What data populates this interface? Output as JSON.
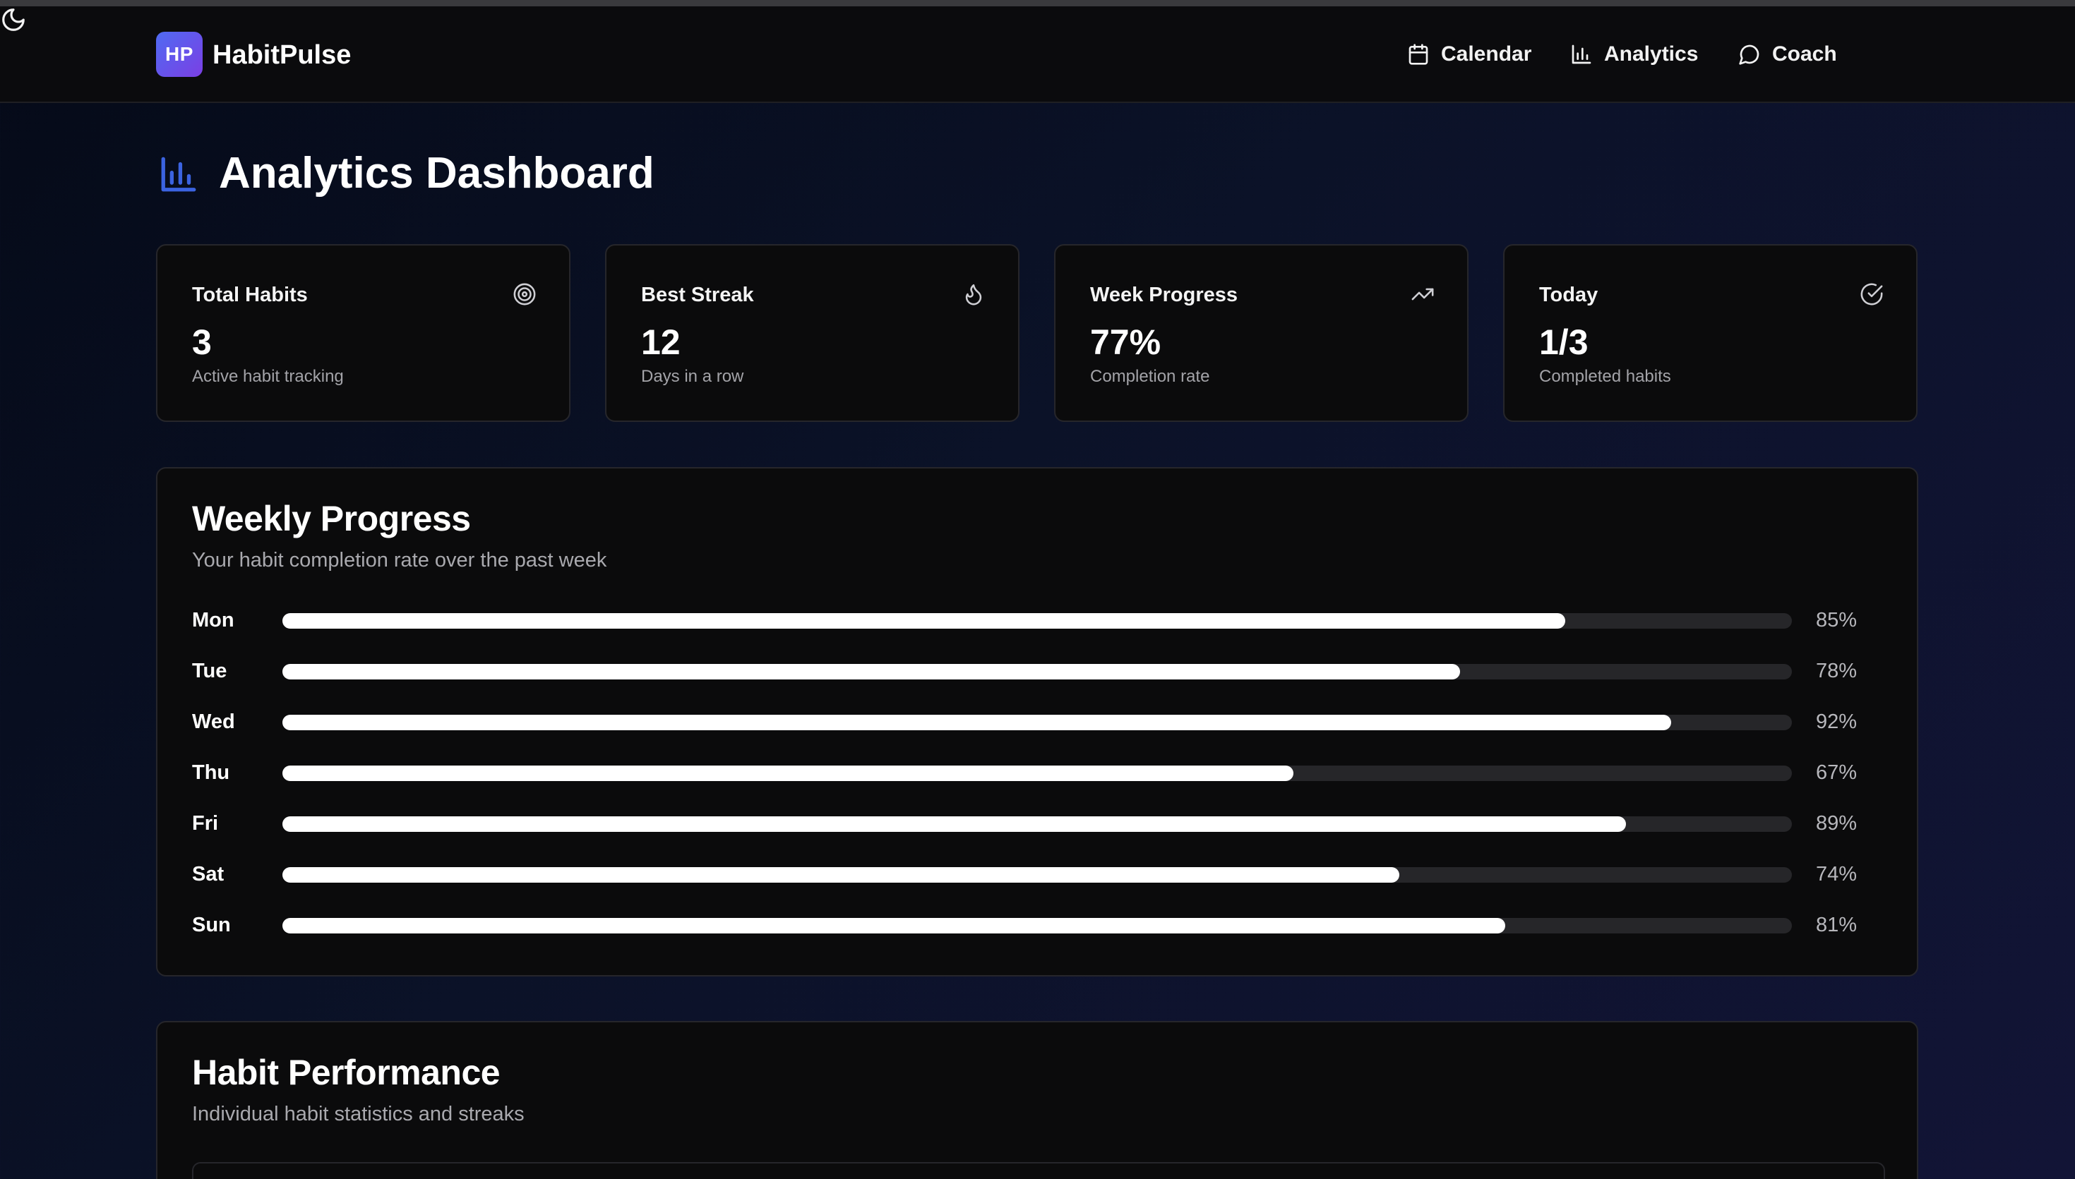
{
  "brand": {
    "logo_text": "HP",
    "name": "HabitPulse"
  },
  "nav": {
    "calendar": "Calendar",
    "analytics": "Analytics",
    "coach": "Coach"
  },
  "page": {
    "title": "Analytics Dashboard"
  },
  "stats": [
    {
      "label": "Total Habits",
      "value": "3",
      "sub": "Active habit tracking",
      "icon": "target-icon"
    },
    {
      "label": "Best Streak",
      "value": "12",
      "sub": "Days in a row",
      "icon": "flame-icon"
    },
    {
      "label": "Week Progress",
      "value": "77%",
      "sub": "Completion rate",
      "icon": "trending-up-icon"
    },
    {
      "label": "Today",
      "value": "1/3",
      "sub": "Completed habits",
      "icon": "check-circle-icon"
    }
  ],
  "weekly": {
    "title": "Weekly Progress",
    "subtitle": "Your habit completion rate over the past week",
    "days": [
      {
        "day": "Mon",
        "percent": 85,
        "label": "85%"
      },
      {
        "day": "Tue",
        "percent": 78,
        "label": "78%"
      },
      {
        "day": "Wed",
        "percent": 92,
        "label": "92%"
      },
      {
        "day": "Thu",
        "percent": 67,
        "label": "67%"
      },
      {
        "day": "Fri",
        "percent": 89,
        "label": "89%"
      },
      {
        "day": "Sat",
        "percent": 74,
        "label": "74%"
      },
      {
        "day": "Sun",
        "percent": 81,
        "label": "81%"
      }
    ]
  },
  "performance": {
    "title": "Habit Performance",
    "subtitle": "Individual habit statistics and streaks"
  },
  "colors": {
    "accent_gradient_start": "#4f6bf2",
    "accent_gradient_end": "#7b3fe4",
    "title_icon": "#3b63e0",
    "bar_fill": "#ffffff",
    "bar_track": "#262629"
  }
}
